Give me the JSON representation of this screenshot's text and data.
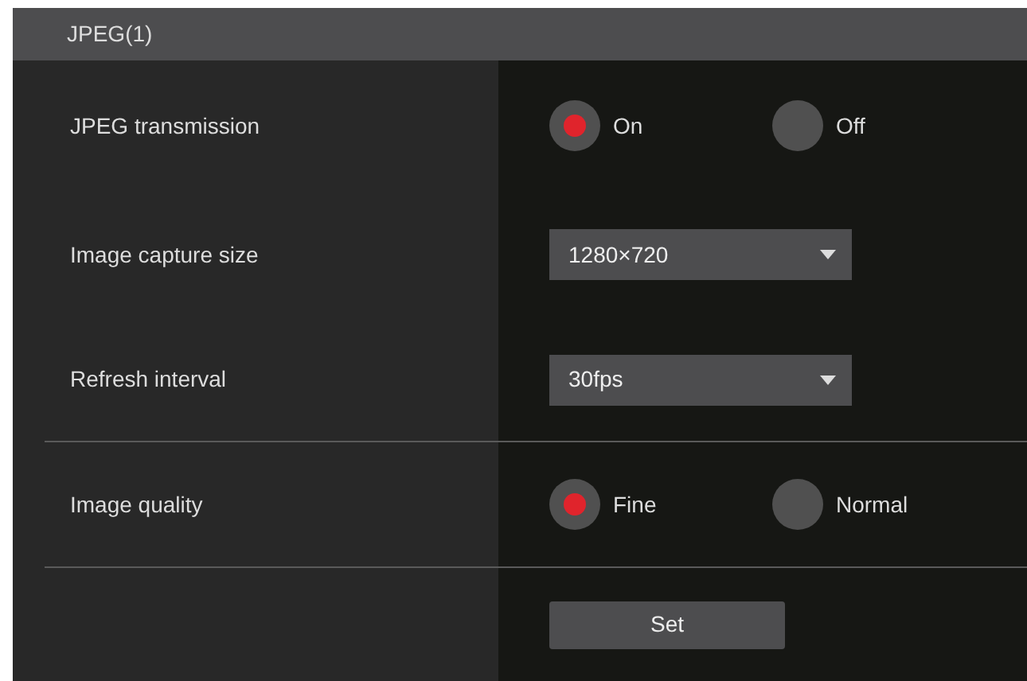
{
  "panel": {
    "title": "JPEG(1)"
  },
  "rows": [
    {
      "kind": "radio",
      "label": "JPEG transmission",
      "options": [
        {
          "label": "On",
          "selected": true
        },
        {
          "label": "Off",
          "selected": false
        }
      ],
      "divider": false
    },
    {
      "kind": "select",
      "label": "Image capture size",
      "value": "1280×720",
      "divider": false
    },
    {
      "kind": "select",
      "label": "Refresh interval",
      "value": "30fps",
      "divider": true
    },
    {
      "kind": "radio",
      "label": "Image quality",
      "options": [
        {
          "label": "Fine",
          "selected": true
        },
        {
          "label": "Normal",
          "selected": false
        }
      ],
      "divider": true
    },
    {
      "kind": "button",
      "label": "Set",
      "divider": false
    }
  ]
}
